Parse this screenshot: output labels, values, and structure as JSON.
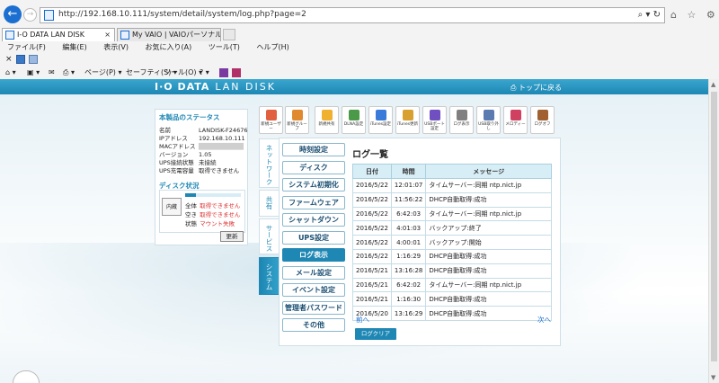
{
  "browser": {
    "url": "http://192.168.10.111/system/detail/system/log.php?page=2",
    "address_icons": "⌕ ▾ ↻",
    "right_icons": "⌂ ☆ ⚙ ☺",
    "tabs": [
      {
        "label": "I-O DATA LAN DISK",
        "close": "×"
      },
      {
        "label": "My VAIO | VAIOパーソナルコンピュ...",
        "close": ""
      }
    ],
    "menu": [
      "ファイル(F)",
      "編集(E)",
      "表示(V)",
      "お気に入り(A)",
      "ツール(T)",
      "ヘルプ(H)"
    ],
    "command": {
      "home": "⌂ ▾",
      "feeds": "▣ ▾",
      "mail": "✉",
      "print": "⎙ ▾",
      "page": "ページ(P) ▾",
      "safety": "セーフティ(S) ▾",
      "tools": "ツール(O) ▾",
      "help": "? ▾"
    }
  },
  "header": {
    "brand": "I·O DATA",
    "product": "LAN DISK",
    "top_link": "⎙ トップに戻る"
  },
  "status": {
    "title": "本製品のステータス",
    "rows": [
      {
        "k": "名前",
        "v": "LANDISK-F24676"
      },
      {
        "k": "IPアドレス",
        "v": "192.168.10.111"
      },
      {
        "k": "MACアドレス",
        "v": "██████████"
      },
      {
        "k": "バージョン",
        "v": "1.05"
      },
      {
        "k": "UPS接続状態",
        "v": "未接続"
      },
      {
        "k": "UPS充電容量",
        "v": "取得できません"
      }
    ],
    "disk_title": "ディスク状況",
    "disk_label": "内蔵",
    "disk_used_fraction": 0.2,
    "disk_rows": [
      {
        "k": "全体",
        "v": "取得できません"
      },
      {
        "k": "空き",
        "v": "取得できません"
      },
      {
        "k": "状態",
        "v": "マウント失敗"
      }
    ],
    "refresh": "更新"
  },
  "icons": [
    {
      "label": "新規ユーザー",
      "color": "#e06040"
    },
    {
      "label": "新規グループ",
      "color": "#e08a30"
    },
    {
      "label": "新規共有",
      "color": "#f0b030"
    },
    {
      "label": "DLNA設定",
      "color": "#4a9a4a"
    },
    {
      "label": "iTunes設定",
      "color": "#3a7ad8"
    },
    {
      "label": "iTunes更新",
      "color": "#d8a030"
    },
    {
      "label": "USBポート設定",
      "color": "#7050c0"
    },
    {
      "label": "ログ表示",
      "color": "#808080"
    },
    {
      "label": "USB取り外し",
      "color": "#5a7ab0"
    },
    {
      "label": "メロディー",
      "color": "#d04060"
    },
    {
      "label": "ログオフ",
      "color": "#a06030"
    }
  ],
  "vtabs": [
    {
      "label": "ネットワーク"
    },
    {
      "label": "共有"
    },
    {
      "label": "サービス"
    },
    {
      "label": "システム"
    }
  ],
  "menu_buttons": [
    {
      "label": "時刻設定"
    },
    {
      "label": "ディスク"
    },
    {
      "label": "システム初期化"
    },
    {
      "label": "ファームウェア"
    },
    {
      "label": "シャットダウン"
    },
    {
      "label": "UPS設定"
    },
    {
      "label": "ログ表示"
    },
    {
      "label": "メール設定"
    },
    {
      "label": "イベント設定"
    },
    {
      "label": "管理者パスワード"
    },
    {
      "label": "その他"
    }
  ],
  "log": {
    "title": "ログ一覧",
    "columns": [
      "日付",
      "時間",
      "メッセージ"
    ],
    "rows": [
      [
        "2016/5/22",
        "12:01:07",
        "タイムサーバー:同期 ntp.nict.jp"
      ],
      [
        "2016/5/22",
        "11:56:22",
        "DHCP自動取得:成功"
      ],
      [
        "2016/5/22",
        "6:42:03",
        "タイムサーバー:同期 ntp.nict.jp"
      ],
      [
        "2016/5/22",
        "4:01:03",
        "バックアップ:終了"
      ],
      [
        "2016/5/22",
        "4:00:01",
        "バックアップ:開始"
      ],
      [
        "2016/5/22",
        "1:16:29",
        "DHCP自動取得:成功"
      ],
      [
        "2016/5/21",
        "13:16:28",
        "DHCP自動取得:成功"
      ],
      [
        "2016/5/21",
        "6:42:02",
        "タイムサーバー:同期 ntp.nict.jp"
      ],
      [
        "2016/5/21",
        "1:16:30",
        "DHCP自動取得:成功"
      ],
      [
        "2016/5/20",
        "13:16:29",
        "DHCP自動取得:成功"
      ]
    ],
    "prev": "前へ",
    "next": "次へ",
    "clear": "ログクリア"
  }
}
